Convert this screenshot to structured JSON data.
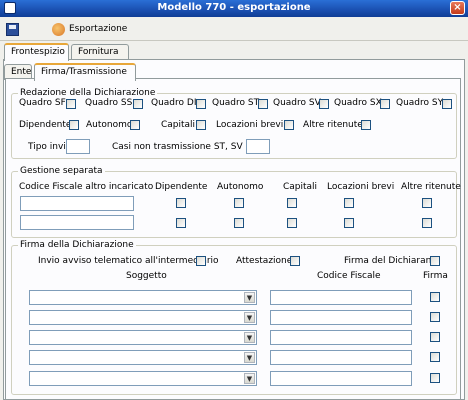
{
  "window": {
    "title": "Modello 770 - esportazione",
    "close_glyph": "×"
  },
  "toolbar": {
    "export_label": "Esportazione"
  },
  "tabs": {
    "frontespizio": "Frontespizio",
    "fornitura": "Fornitura"
  },
  "subtabs": {
    "ente": "Ente",
    "firma": "Firma/Trasmissione"
  },
  "redazione": {
    "title": "Redazione della Dichiarazione",
    "quadri": [
      "Quadro SF",
      "Quadro SS",
      "Quadro DI",
      "Quadro ST",
      "Quadro SV",
      "Quadro SX",
      "Quadro SY"
    ],
    "dipendente": "Dipendente",
    "autonomo": "Autonomo",
    "capitali": "Capitali",
    "locazioni": "Locazioni brevi",
    "altre": "Altre ritenute",
    "tipo_invio": "Tipo invio",
    "casi": "Casi non trasmissione ST, SV e SX"
  },
  "gestione": {
    "title": "Gestione separata",
    "codice": "Codice Fiscale altro incaricato",
    "dipendente": "Dipendente",
    "autonomo": "Autonomo",
    "capitali": "Capitali",
    "locazioni": "Locazioni brevi",
    "altre": "Altre ritenute"
  },
  "firma": {
    "title": "Firma della Dichiarazione",
    "invio_avviso": "Invio avviso telematico all'intermediario",
    "attestazione": "Attestazione",
    "firma_dichiarante": "Firma del Dichiarante",
    "soggetto": "Soggetto",
    "codice_fiscale": "Codice Fiscale",
    "firma": "Firma",
    "combo_arrow": "▼"
  }
}
